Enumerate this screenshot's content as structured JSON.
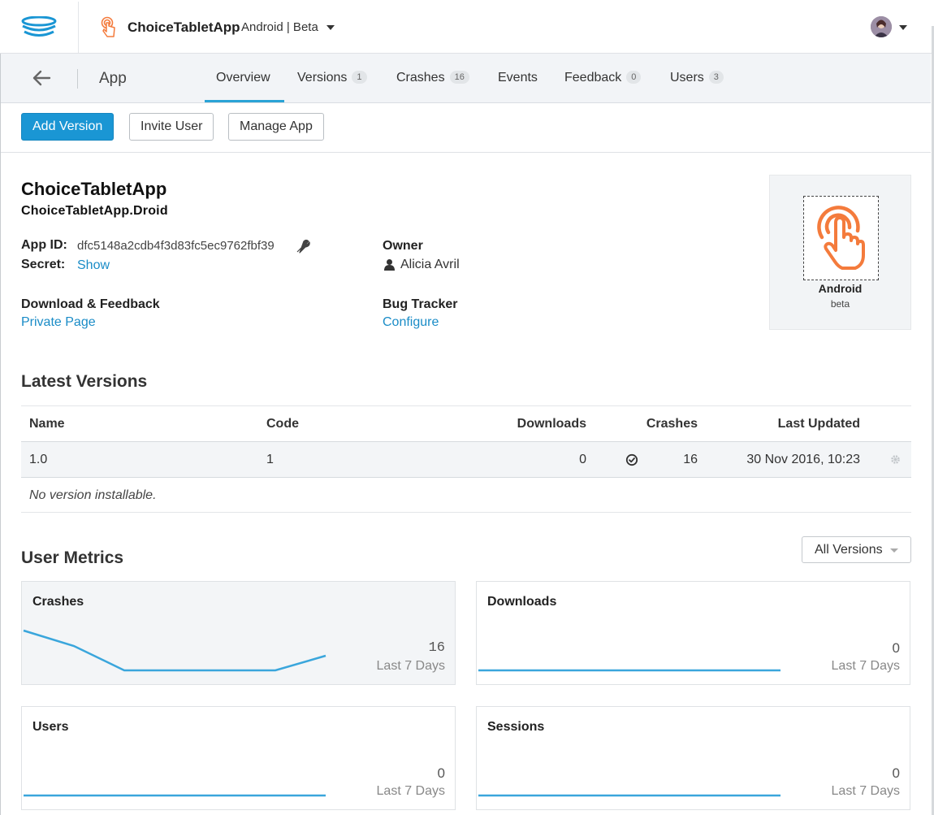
{
  "header": {
    "app_name": "ChoiceTabletApp",
    "app_platform": "Android | Beta"
  },
  "subnav": {
    "title": "App",
    "tabs": [
      {
        "label": "Overview",
        "badge": null,
        "active": true
      },
      {
        "label": "Versions",
        "badge": "1"
      },
      {
        "label": "Crashes",
        "badge": "16"
      },
      {
        "label": "Events",
        "badge": null
      },
      {
        "label": "Feedback",
        "badge": "0"
      },
      {
        "label": "Users",
        "badge": "3"
      }
    ]
  },
  "actions": {
    "add_version": "Add Version",
    "invite_user": "Invite User",
    "manage_app": "Manage App"
  },
  "app_info": {
    "title": "ChoiceTabletApp",
    "bundle_id": "ChoiceTabletApp.Droid",
    "app_id_label": "App ID:",
    "app_id": "dfc5148a2cdb4f3d83fc5ec9762fbf39",
    "secret_label": "Secret:",
    "secret_link": "Show",
    "owner_label": "Owner",
    "owner_name": "Alicia Avril",
    "download_label": "Download & Feedback",
    "download_link": "Private Page",
    "bug_label": "Bug Tracker",
    "bug_link": "Configure",
    "platform": "Android",
    "release": "beta"
  },
  "latest_versions": {
    "title": "Latest Versions",
    "columns": [
      "Name",
      "Code",
      "Downloads",
      "Crashes",
      "Last Updated"
    ],
    "rows": [
      {
        "name": "1.0",
        "code": "1",
        "downloads": "0",
        "crashes": "16",
        "last_updated": "30 Nov 2016, 10:23"
      }
    ],
    "footer": "No version installable."
  },
  "user_metrics": {
    "title": "User Metrics",
    "filter": "All Versions",
    "cards": [
      {
        "title": "Crashes",
        "value": "16",
        "period": "Last 7 Days"
      },
      {
        "title": "Downloads",
        "value": "0",
        "period": "Last 7 Days"
      },
      {
        "title": "Users",
        "value": "0",
        "period": "Last 7 Days"
      },
      {
        "title": "Sessions",
        "value": "0",
        "period": "Last 7 Days"
      }
    ]
  },
  "colors": {
    "accent": "#1a96d4",
    "link": "#1a8cc7",
    "app_icon": "#f47b3c",
    "sparkline": "#3aa6dc"
  }
}
